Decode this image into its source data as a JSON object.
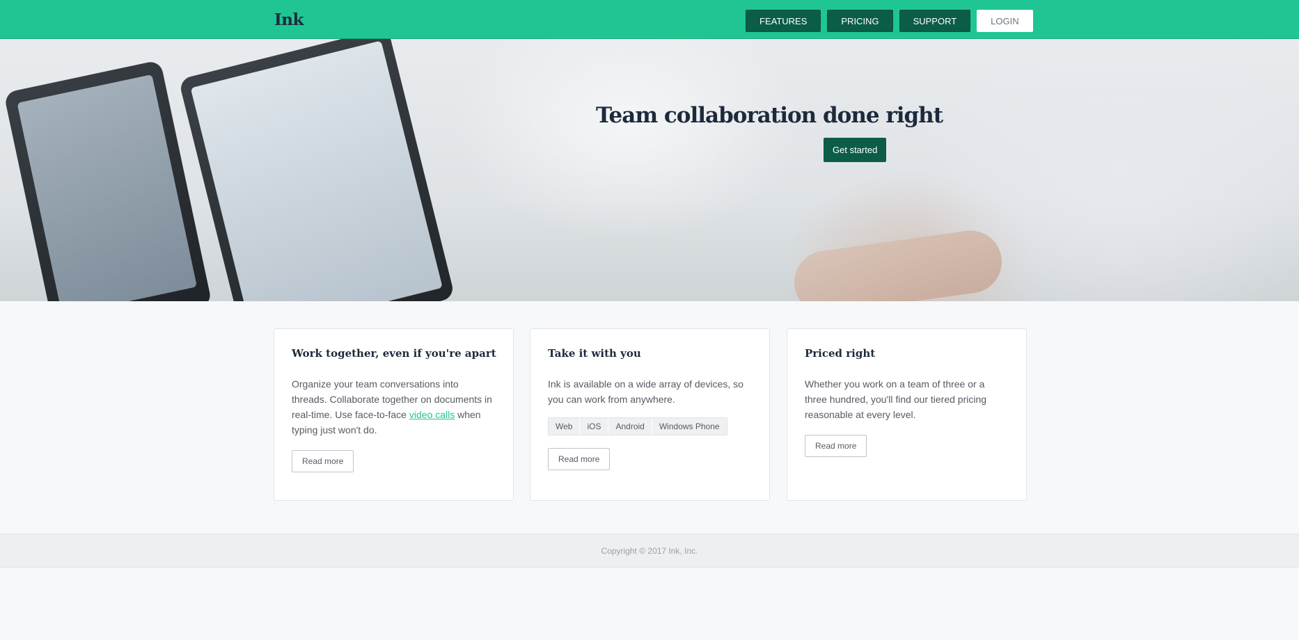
{
  "header": {
    "logo": "Ink",
    "nav": [
      {
        "label": "FEATURES"
      },
      {
        "label": "PRICING"
      },
      {
        "label": "SUPPORT"
      },
      {
        "label": "LOGIN"
      }
    ]
  },
  "hero": {
    "title": "Team collaboration done right",
    "cta": "Get started"
  },
  "cards": [
    {
      "title": "Work together, even if you're apart",
      "text_before_link": "Organize your team conversations into threads. Collaborate together on documents in real-time. Use face-to-face ",
      "link": "video calls",
      "text_after_link": " when typing just won't do.",
      "button": "Read more"
    },
    {
      "title": "Take it with you",
      "text": "Ink is available on a wide array of devices, so you can work from anywhere.",
      "platforms": [
        "Web",
        "iOS",
        "Android",
        "Windows Phone"
      ],
      "button": "Read more"
    },
    {
      "title": "Priced right",
      "text": "Whether you work on a team of three or a three hundred, you'll find our tiered pricing reasonable at every level.",
      "button": "Read more"
    }
  ],
  "footer": {
    "copyright": "Copyright © 2017 Ink, Inc."
  },
  "colors": {
    "accent": "#1fc693",
    "button_dark": "#0b5d48",
    "heading": "#1d2a3c",
    "background": "#f7f8fa"
  }
}
